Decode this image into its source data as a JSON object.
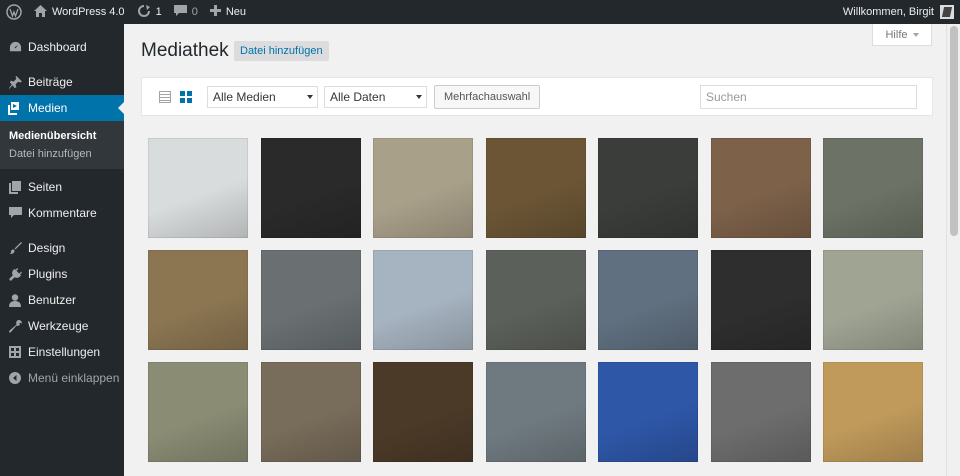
{
  "adminbar": {
    "site_name": "WordPress 4.0",
    "updates_count": "1",
    "comments_count": "0",
    "new_label": "Neu",
    "greeting": "Willkommen, Birgit"
  },
  "sidebar": {
    "items": [
      {
        "label": "Dashboard",
        "icon": "dashboard-icon"
      },
      {
        "label": "Beiträge",
        "icon": "pin-icon"
      },
      {
        "label": "Medien",
        "icon": "media-icon"
      },
      {
        "label": "Seiten",
        "icon": "pages-icon"
      },
      {
        "label": "Kommentare",
        "icon": "comment-icon"
      },
      {
        "label": "Design",
        "icon": "brush-icon"
      },
      {
        "label": "Plugins",
        "icon": "plug-icon"
      },
      {
        "label": "Benutzer",
        "icon": "user-icon"
      },
      {
        "label": "Werkzeuge",
        "icon": "wrench-icon"
      },
      {
        "label": "Einstellungen",
        "icon": "settings-icon"
      }
    ],
    "submenu": [
      "Medienübersicht",
      "Datei hinzufügen"
    ],
    "collapse_label": "Menü einklappen"
  },
  "main": {
    "help_label": "Hilfe",
    "title": "Mediathek",
    "add_new_label": "Datei hinzufügen",
    "filter_type": "Alle Medien",
    "filter_date": "Alle Daten",
    "bulk_select_label": "Mehrfachauswahl",
    "search_placeholder": "Suchen"
  },
  "media_grid": {
    "colors": [
      "#d9dcdd",
      "#2a2a2a",
      "#a9a08a",
      "#6b5535",
      "#3a3d3a",
      "#7d6149",
      "#6c7265",
      "#8c7652",
      "#6a7072",
      "#a6b3c0",
      "#5c605a",
      "#607080",
      "#2e2e2e",
      "#9fa493",
      "#8a8c74",
      "#786c5a",
      "#4c3a28",
      "#6f7a80",
      "#2e57a8",
      "#6d6d6d",
      "#c09a5b"
    ]
  },
  "colors": {
    "adminbar_bg": "#23282d",
    "accent": "#0073aa",
    "page_bg": "#f1f1f1"
  }
}
